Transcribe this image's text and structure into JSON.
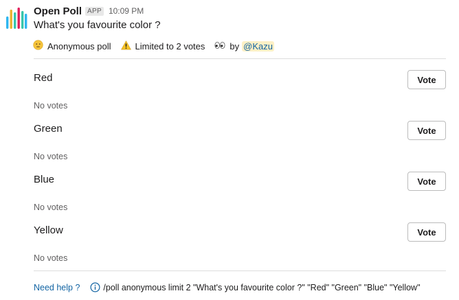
{
  "app": {
    "name": "Open Poll",
    "badge": "APP",
    "time": "10:09 PM",
    "avatar_colors": [
      "#2eb6f0",
      "#ecb22e",
      "#36c5ab",
      "#e01e5a",
      "#36c5ab",
      "#2eb6f0"
    ]
  },
  "poll": {
    "question": "What's you favourite color ?",
    "meta": {
      "anonymous_icon": "neutral-face-icon",
      "anonymous_label": "Anonymous poll",
      "limit_icon": "warning-icon",
      "limit_label": "Limited to 2 votes",
      "author_icon": "eyes-icon",
      "by_label": "by",
      "author": "@Kazu"
    },
    "options": [
      {
        "label": "Red",
        "button": "Vote",
        "votes_text": "No votes"
      },
      {
        "label": "Green",
        "button": "Vote",
        "votes_text": "No votes"
      },
      {
        "label": "Blue",
        "button": "Vote",
        "votes_text": "No votes"
      },
      {
        "label": "Yellow",
        "button": "Vote",
        "votes_text": "No votes"
      }
    ]
  },
  "footer": {
    "help_label": "Need help ?",
    "info_icon": "info-icon",
    "command": "/poll anonymous limit 2 \"What's you favourite color ?\" \"Red\" \"Green\" \"Blue\" \"Yellow\""
  }
}
